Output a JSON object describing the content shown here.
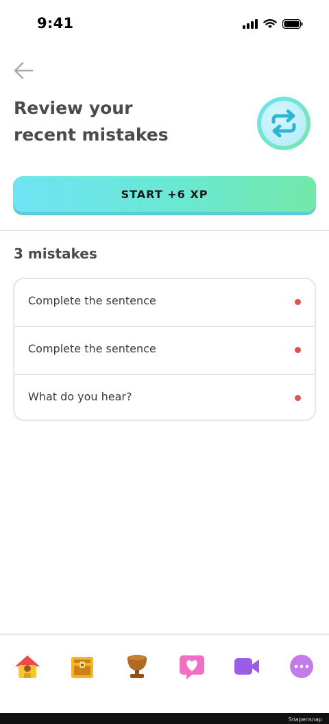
{
  "status_bar": {
    "time": "9:41",
    "icons": [
      "cellular-signal-icon",
      "wifi-icon",
      "battery-icon"
    ]
  },
  "header": {
    "back_icon": "arrow-left-icon",
    "title_line1": "Review your",
    "title_line2": "recent mistakes",
    "badge_icon": "refresh-arrows-icon"
  },
  "start_button": {
    "label": "START +6 XP"
  },
  "mistakes": {
    "count_label": "3 mistakes",
    "items": [
      {
        "label": "Complete the sentence"
      },
      {
        "label": "Complete the sentence"
      },
      {
        "label": "What do you hear?"
      }
    ],
    "dot_color": "#e0524e"
  },
  "bottom_nav": {
    "items": [
      {
        "icon": "home-icon"
      },
      {
        "icon": "treasure-chest-icon"
      },
      {
        "icon": "trophy-icon"
      },
      {
        "icon": "heart-message-icon"
      },
      {
        "icon": "video-camera-icon"
      },
      {
        "icon": "more-icon"
      }
    ]
  },
  "footer": {
    "watermark": "Snapensnap"
  },
  "colors": {
    "accent_gradient_start": "#6ee3f4",
    "accent_gradient_end": "#74e8a9",
    "text_primary": "#4b4b4b",
    "border": "#e5e5e5"
  }
}
